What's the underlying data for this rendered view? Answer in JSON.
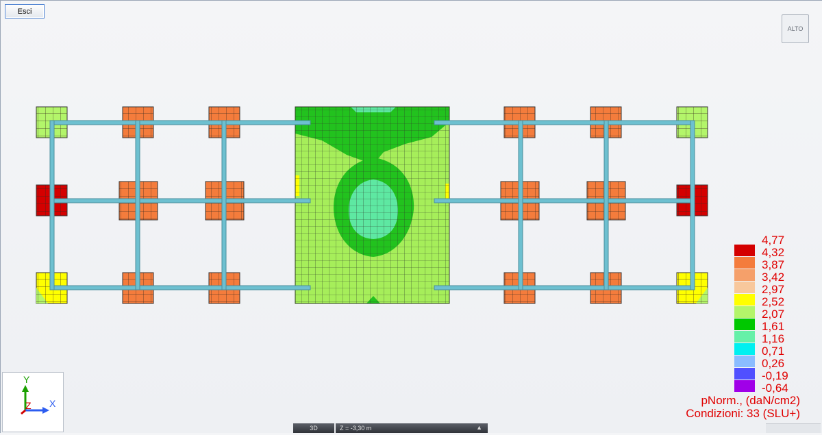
{
  "toolbar": {
    "exit_label": "Esci",
    "view_button_label": "ALTO"
  },
  "legend": {
    "entries": [
      {
        "value": "4,77",
        "color": "#d40000"
      },
      {
        "value": "4,32",
        "color": "#f47c3c"
      },
      {
        "value": "3,87",
        "color": "#f5a06a"
      },
      {
        "value": "3,42",
        "color": "#f8c89c"
      },
      {
        "value": "2,97",
        "color": "#ffff00"
      },
      {
        "value": "2,52",
        "color": "#b3f56a"
      },
      {
        "value": "2,07",
        "color": "#00c800"
      },
      {
        "value": "1,61",
        "color": "#66f0a8"
      },
      {
        "value": "1,16",
        "color": "#00f0f0"
      },
      {
        "value": "0,71",
        "color": "#8abcff"
      },
      {
        "value": "0,26",
        "color": "#5050ff"
      },
      {
        "value": "-0,19",
        "color": "#a000e8"
      },
      {
        "value": "-0,64",
        "color": "#ff00ff"
      }
    ],
    "caption_quantity": "pNorm., (daN/cm2)",
    "caption_conditions": "Condizioni: 33 (SLU+)"
  },
  "axes": {
    "x_label": "X",
    "y_label": "Y",
    "z_label": "Z"
  },
  "status_bar": {
    "view_mode": "3D",
    "z_level": "Z = -3,30 m"
  },
  "model_colors": {
    "beam": "#6dc0d0",
    "footing_orange": "#f47c3c",
    "footing_red": "#d40000",
    "footing_lightgreen": "#b3f56a",
    "footing_yellow": "#ffff00",
    "slab_base": "#a6ee5a",
    "slab_band": "#22c21e",
    "slab_core": "#5ee8a2"
  }
}
